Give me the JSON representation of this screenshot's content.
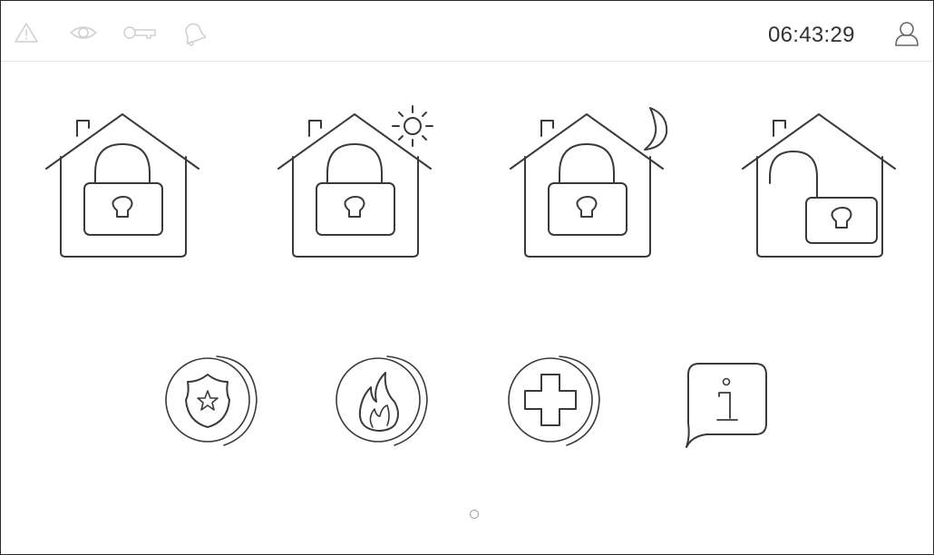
{
  "status_bar": {
    "icons": [
      "warning-icon",
      "eye-icon",
      "key-icon",
      "bell-icon"
    ],
    "time": "06:43:29",
    "user_icon": "user-icon"
  },
  "arming_modes": [
    {
      "icon": "house-locked-icon"
    },
    {
      "icon": "house-locked-day-icon"
    },
    {
      "icon": "house-locked-night-icon"
    },
    {
      "icon": "house-unlocked-icon"
    }
  ],
  "alarm_buttons": [
    {
      "icon": "police-badge-icon"
    },
    {
      "icon": "fire-flame-icon"
    },
    {
      "icon": "medical-cross-icon"
    },
    {
      "icon": "info-bubble-icon"
    }
  ],
  "pagination": {
    "pages": 1,
    "current": 1
  },
  "colors": {
    "line": "#3a3a3a",
    "faint": "#cfcfcf",
    "background": "#ffffff"
  }
}
